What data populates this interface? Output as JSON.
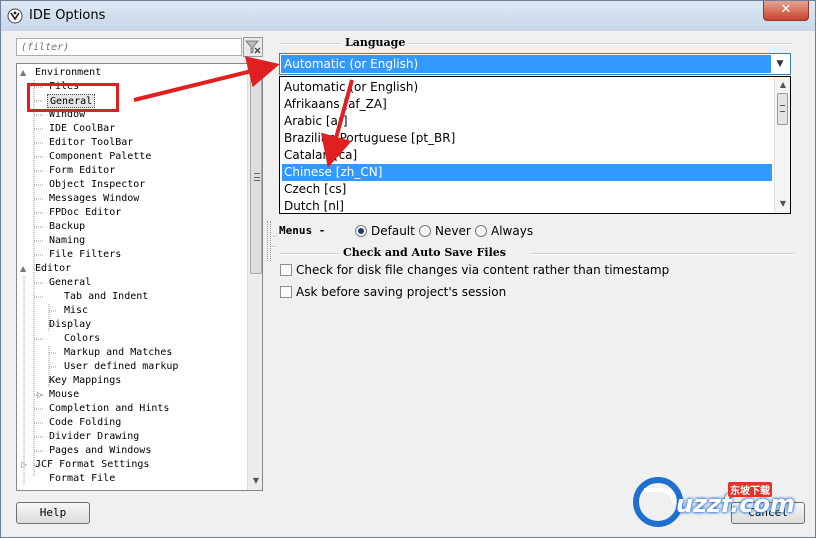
{
  "window": {
    "title": "IDE Options",
    "close_label": "✕"
  },
  "filter": {
    "placeholder": "(filter)"
  },
  "tree": {
    "items": [
      {
        "label": "Environment"
      },
      {
        "label": "Files"
      },
      {
        "label": "General"
      },
      {
        "label": "Window"
      },
      {
        "label": "IDE CoolBar"
      },
      {
        "label": "Editor ToolBar"
      },
      {
        "label": "Component Palette"
      },
      {
        "label": "Form Editor"
      },
      {
        "label": "Object Inspector"
      },
      {
        "label": "Messages Window"
      },
      {
        "label": "FPDoc Editor"
      },
      {
        "label": "Backup"
      },
      {
        "label": "Naming"
      },
      {
        "label": "File Filters"
      },
      {
        "label": "Editor"
      },
      {
        "label": "General"
      },
      {
        "label": "Tab and Indent"
      },
      {
        "label": "Misc"
      },
      {
        "label": "Display"
      },
      {
        "label": "Colors"
      },
      {
        "label": "Markup and Matches"
      },
      {
        "label": "User defined markup"
      },
      {
        "label": "Key Mappings"
      },
      {
        "label": "Mouse"
      },
      {
        "label": "Completion and Hints"
      },
      {
        "label": "Code Folding"
      },
      {
        "label": "Divider Drawing"
      },
      {
        "label": "Pages and Windows"
      },
      {
        "label": "JCF Format Settings"
      },
      {
        "label": "Format File"
      }
    ],
    "selected": "General"
  },
  "language": {
    "caption": "Language",
    "current_value": "Automatic (or English)",
    "options": [
      "Automatic (or English)",
      "Afrikaans [af_ZA]",
      "Arabic [ar]",
      "Brazilian Portuguese [pt_BR]",
      "Catalan [ca]",
      "Chinese [zh_CN]",
      "Czech [cs]",
      "Dutch [nl]"
    ],
    "highlighted_option": "Chinese [zh_CN]"
  },
  "menus": {
    "label": "Menus",
    "options": [
      "Default",
      "Never",
      "Always"
    ],
    "selected": "Default"
  },
  "autosave": {
    "caption": "Check and Auto Save Files",
    "checkboxes": [
      {
        "label": "Check for disk file changes via content rather than timestamp",
        "checked": false
      },
      {
        "label": "Ask before saving project's session",
        "checked": false
      }
    ]
  },
  "buttons": {
    "help": "Help",
    "cancel": "Cancel"
  },
  "watermark": {
    "text": "uzzf.com",
    "tag": "东坡下载"
  },
  "colors": {
    "selection": "#3399ff",
    "annotation": "#e02020"
  }
}
